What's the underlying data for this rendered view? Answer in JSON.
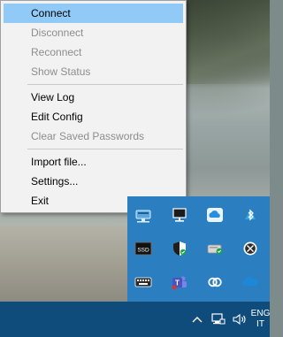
{
  "context_menu": {
    "items": [
      {
        "label": "Connect",
        "enabled": true,
        "highlighted": true
      },
      {
        "label": "Disconnect",
        "enabled": false
      },
      {
        "label": "Reconnect",
        "enabled": false
      },
      {
        "label": "Show Status",
        "enabled": false
      },
      {
        "separator": true
      },
      {
        "label": "View Log",
        "enabled": true
      },
      {
        "label": "Edit Config",
        "enabled": true
      },
      {
        "label": "Clear Saved Passwords",
        "enabled": false
      },
      {
        "separator": true
      },
      {
        "label": "Import file...",
        "enabled": true
      },
      {
        "label": "Settings...",
        "enabled": true
      },
      {
        "label": "Exit",
        "enabled": true
      }
    ]
  },
  "tray_flyout": {
    "icons": [
      "network-drive-icon",
      "network-monitor-icon",
      "cloud-icon",
      "bluetooth-icon",
      "ssd-icon",
      "windows-security-icon",
      "drive-check-icon",
      "xbox-icon",
      "keyboard-icon",
      "teams-icon",
      "creative-cloud-icon",
      "onedrive-icon"
    ],
    "ssd_label": "SSD"
  },
  "taskbar": {
    "language_line1": "ENG",
    "language_line2": "IT"
  },
  "colors": {
    "menu_background": "#f2f2f2",
    "menu_highlight": "#91c9f7",
    "flyout_background": "#2b7fc0",
    "taskbar_background": "#0f4c7c"
  }
}
